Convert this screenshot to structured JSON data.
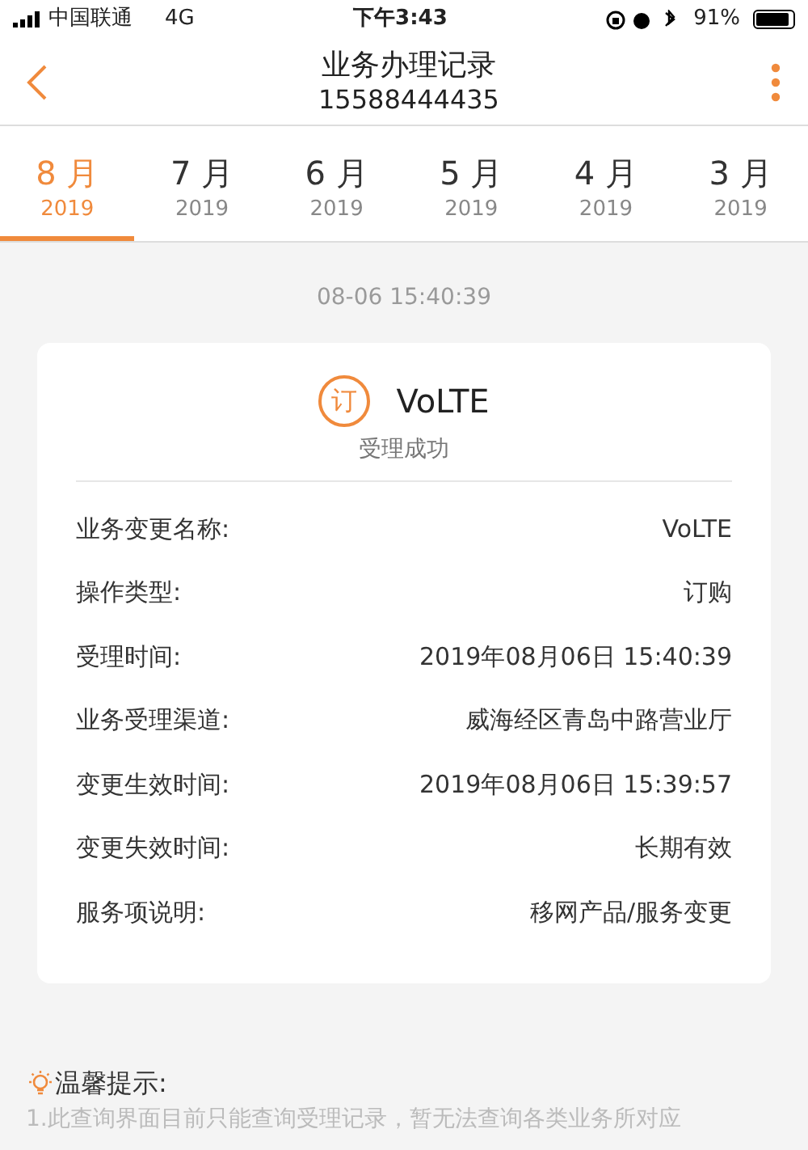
{
  "status_bar": {
    "carrier": "中国联通",
    "network": "4G",
    "time": "下午3:43",
    "battery": "91%"
  },
  "header": {
    "title": "业务办理记录",
    "subtitle": "15588444435"
  },
  "tabs": [
    {
      "month": "8 月",
      "year": "2019",
      "selected": true
    },
    {
      "month": "7 月",
      "year": "2019",
      "selected": false
    },
    {
      "month": "6 月",
      "year": "2019",
      "selected": false
    },
    {
      "month": "5 月",
      "year": "2019",
      "selected": false
    },
    {
      "month": "4 月",
      "year": "2019",
      "selected": false
    },
    {
      "month": "3 月",
      "year": "2019",
      "selected": false
    }
  ],
  "timestamp": "08-06 15:40:39",
  "record": {
    "badge": "订",
    "name": "VoLTE",
    "status": "受理成功",
    "fields": [
      {
        "label": "业务变更名称:",
        "value": "VoLTE"
      },
      {
        "label": "操作类型:",
        "value": "订购"
      },
      {
        "label": "受理时间:",
        "value": "2019年08月06日 15:40:39"
      },
      {
        "label": "业务受理渠道:",
        "value": "威海经区青岛中路营业厅"
      },
      {
        "label": "变更生效时间:",
        "value": "2019年08月06日 15:39:57"
      },
      {
        "label": "变更失效时间:",
        "value": "长期有效"
      },
      {
        "label": "服务项说明:",
        "value": "移网产品/服务变更"
      }
    ]
  },
  "tips": {
    "title": "温馨提示:",
    "text": "1.此查询界面目前只能查询受理记录，暂无法查询各类业务所对应"
  }
}
